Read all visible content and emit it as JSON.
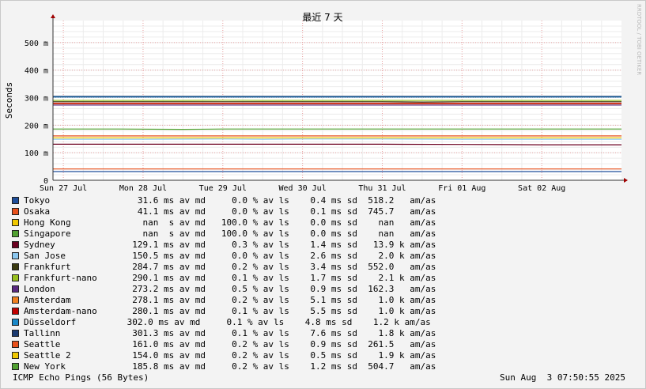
{
  "watermark": "RRDTOOL / TOBI OETIKER",
  "chart_data": {
    "type": "line",
    "title": "最近 7 天",
    "ylabel": "Seconds",
    "y_tick_labels": [
      "0",
      "100 m",
      "200 m",
      "300 m",
      "400 m",
      "500 m"
    ],
    "y_ticks": [
      0,
      0.1,
      0.2,
      0.3,
      0.4,
      0.5
    ],
    "ylim": [
      0,
      0.58
    ],
    "x_tick_labels": [
      "Sun 27 Jul",
      "Mon 28 Jul",
      "Tue 29 Jul",
      "Wed 30 Jul",
      "Thu 31 Jul",
      "Fri 01 Aug",
      "Sat 02 Aug"
    ],
    "x_ticks": [
      0,
      1,
      2,
      3,
      4,
      5,
      6
    ],
    "xlim": [
      -0.13,
      7.0
    ],
    "grid": true,
    "series": [
      {
        "name": "Tokyo",
        "color": "#1f4e9a",
        "x": [
          -0.13,
          0.8,
          1.7,
          2.0,
          2.5,
          3.0,
          3.5,
          4.0,
          4.5,
          5.0,
          5.5,
          6.0,
          7.0
        ],
        "values": [
          0.0316,
          0.0316,
          0.0316,
          0.0316,
          0.0316,
          0.0316,
          0.0316,
          0.0316,
          0.0316,
          0.0316,
          0.0316,
          0.0316,
          0.0316
        ]
      },
      {
        "name": "Osaka",
        "color": "#e8511c",
        "x": [
          -0.13,
          0.8,
          1.7,
          2.0,
          2.5,
          3.0,
          3.5,
          4.0,
          4.5,
          5.0,
          5.5,
          6.0,
          7.0
        ],
        "values": [
          0.0411,
          0.0411,
          0.0411,
          0.0411,
          0.0411,
          0.0411,
          0.0411,
          0.0411,
          0.0411,
          0.0411,
          0.0411,
          0.0411,
          0.0411
        ]
      },
      {
        "name": "Sydney",
        "color": "#6b0020",
        "x": [
          -0.13,
          0.8,
          1.7,
          2.0,
          2.1,
          2.5,
          3.0,
          4.0,
          5.0,
          6.0,
          7.0
        ],
        "values": [
          0.131,
          0.131,
          0.131,
          0.131,
          0.131,
          0.131,
          0.131,
          0.131,
          0.13,
          0.129,
          0.129
        ]
      },
      {
        "name": "San Jose",
        "color": "#8cc8f0",
        "x": [
          -0.13,
          1.0,
          2.0,
          2.5,
          3.0,
          4.0,
          5.0,
          6.0,
          7.0
        ],
        "values": [
          0.149,
          0.149,
          0.15,
          0.149,
          0.15,
          0.15,
          0.149,
          0.149,
          0.149
        ]
      },
      {
        "name": "Frankfurt",
        "color": "#3a3a10",
        "x": [
          -0.13,
          0.7,
          1.5,
          2.0,
          2.5,
          3.0,
          3.5,
          4.0,
          4.5,
          5.0,
          5.5,
          6.0,
          7.0
        ],
        "values": [
          0.285,
          0.285,
          0.285,
          0.285,
          0.285,
          0.285,
          0.285,
          0.285,
          0.284,
          0.285,
          0.285,
          0.285,
          0.285
        ]
      },
      {
        "name": "Frankfurt-nano",
        "color": "#98c020",
        "x": [
          -0.13,
          0.7,
          1.5,
          2.0,
          2.5,
          3.0,
          3.5,
          4.0,
          4.5,
          5.0,
          5.5,
          6.0,
          7.0
        ],
        "values": [
          0.29,
          0.29,
          0.29,
          0.291,
          0.29,
          0.29,
          0.29,
          0.29,
          0.29,
          0.29,
          0.29,
          0.29,
          0.29
        ]
      },
      {
        "name": "London",
        "color": "#5a2a80",
        "x": [
          -0.13,
          0.7,
          1.5,
          2.0,
          2.5,
          3.0,
          3.5,
          4.0,
          4.5,
          5.0,
          5.5,
          6.0,
          7.0
        ],
        "values": [
          0.273,
          0.273,
          0.273,
          0.273,
          0.273,
          0.273,
          0.273,
          0.273,
          0.273,
          0.273,
          0.273,
          0.273,
          0.273
        ]
      },
      {
        "name": "Amsterdam",
        "color": "#f08020",
        "x": [
          -0.13,
          0.7,
          1.5,
          2.0,
          2.5,
          3.0,
          3.5,
          4.0,
          4.5,
          5.0,
          5.5,
          6.0,
          7.0
        ],
        "values": [
          0.278,
          0.278,
          0.278,
          0.278,
          0.278,
          0.278,
          0.278,
          0.278,
          0.278,
          0.278,
          0.278,
          0.278,
          0.278
        ]
      },
      {
        "name": "Amsterdam-nano",
        "color": "#c00000",
        "x": [
          -0.13,
          0.7,
          1.5,
          2.0,
          2.5,
          3.0,
          3.5,
          4.0,
          4.5,
          5.0,
          5.5,
          6.0,
          7.0
        ],
        "values": [
          0.28,
          0.28,
          0.28,
          0.28,
          0.28,
          0.28,
          0.28,
          0.28,
          0.28,
          0.28,
          0.28,
          0.28,
          0.28
        ]
      },
      {
        "name": "Düsseldorf",
        "color": "#1a88c8",
        "x": [
          -0.13,
          0.7,
          1.5,
          2.0,
          2.5,
          3.0,
          3.5,
          4.0,
          4.5,
          5.0,
          5.5,
          6.0,
          7.0
        ],
        "values": [
          0.302,
          0.302,
          0.302,
          0.302,
          0.302,
          0.302,
          0.302,
          0.302,
          0.302,
          0.302,
          0.302,
          0.302,
          0.302
        ]
      },
      {
        "name": "Tallinn",
        "color": "#1a3a70",
        "x": [
          -0.13,
          0.7,
          1.5,
          2.0,
          2.5,
          3.0,
          3.5,
          4.0,
          4.5,
          5.0,
          5.5,
          6.0,
          7.0
        ],
        "values": [
          0.305,
          0.305,
          0.305,
          0.305,
          0.305,
          0.305,
          0.305,
          0.305,
          0.305,
          0.305,
          0.305,
          0.305,
          0.305
        ]
      },
      {
        "name": "Seattle",
        "color": "#e8511c",
        "x": [
          -0.13,
          0.6,
          1.0,
          1.8,
          2.5,
          2.8,
          3.5,
          4.0,
          4.4,
          4.5,
          5.0,
          5.5,
          6.0,
          7.0
        ],
        "values": [
          0.161,
          0.161,
          0.161,
          0.161,
          0.161,
          0.161,
          0.161,
          0.161,
          0.161,
          0.161,
          0.161,
          0.161,
          0.161,
          0.161
        ]
      },
      {
        "name": "Seattle 2",
        "color": "#f0c800",
        "x": [
          -0.13,
          1.0,
          1.8,
          2.0,
          2.5,
          3.0,
          4.0,
          5.0,
          6.0,
          7.0
        ],
        "values": [
          0.154,
          0.154,
          0.154,
          0.154,
          0.154,
          0.154,
          0.154,
          0.154,
          0.154,
          0.154
        ]
      },
      {
        "name": "New York",
        "color": "#50a030",
        "x": [
          -0.13,
          0.7,
          1.5,
          2.0,
          2.5,
          3.0,
          3.5,
          4.0,
          4.5,
          5.0,
          5.5,
          6.0,
          7.0
        ],
        "values": [
          0.186,
          0.186,
          0.185,
          0.186,
          0.186,
          0.186,
          0.186,
          0.186,
          0.186,
          0.186,
          0.186,
          0.186,
          0.186
        ]
      }
    ]
  },
  "legend": [
    {
      "name": "Tokyo",
      "color": "#1f4e9a",
      "stats": "   31.6 ms av md     0.0 % av ls    0.4 ms sd  518.2   am/as"
    },
    {
      "name": "Osaka",
      "color": "#e8511c",
      "stats": "   41.1 ms av md     0.0 % av ls    0.1 ms sd  745.7   am/as"
    },
    {
      "name": "Hong Kong",
      "color": "#f0c800",
      "stats": "    nan  s av md   100.0 % av ls    0.0 ms sd    nan   am/as"
    },
    {
      "name": "Singapore",
      "color": "#50a030",
      "stats": "    nan  s av md   100.0 % av ls    0.0 ms sd    nan   am/as"
    },
    {
      "name": "Sydney",
      "color": "#6b0020",
      "stats": "  129.1 ms av md     0.3 % av ls    1.4 ms sd   13.9 k am/as"
    },
    {
      "name": "San Jose",
      "color": "#8cc8f0",
      "stats": "  150.5 ms av md     0.0 % av ls    2.6 ms sd    2.0 k am/as"
    },
    {
      "name": "Frankfurt",
      "color": "#3a3a10",
      "stats": "  284.7 ms av md     0.2 % av ls    3.4 ms sd  552.0   am/as"
    },
    {
      "name": "Frankfurt-nano",
      "color": "#98c020",
      "stats": "  290.1 ms av md     0.1 % av ls    1.7 ms sd    2.1 k am/as"
    },
    {
      "name": "London",
      "color": "#5a2a80",
      "stats": "  273.2 ms av md     0.5 % av ls    0.9 ms sd  162.3   am/as"
    },
    {
      "name": "Amsterdam",
      "color": "#f08020",
      "stats": "  278.1 ms av md     0.2 % av ls    5.1 ms sd    1.0 k am/as"
    },
    {
      "name": "Amsterdam-nano",
      "color": "#c00000",
      "stats": "  280.1 ms av md     0.1 % av ls    5.5 ms sd    1.0 k am/as"
    },
    {
      "name": "Düsseldorf",
      "color": "#1a88c8",
      "stats": " 302.0 ms av md     0.1 % av ls    4.8 ms sd    1.2 k am/as"
    },
    {
      "name": "Tallinn",
      "color": "#1a3a70",
      "stats": "  301.3 ms av md     0.1 % av ls    7.6 ms sd    1.8 k am/as"
    },
    {
      "name": "Seattle",
      "color": "#e8511c",
      "stats": "  161.0 ms av md     0.2 % av ls    0.9 ms sd  261.5   am/as"
    },
    {
      "name": "Seattle 2",
      "color": "#f0c800",
      "stats": "  154.0 ms av md     0.2 % av ls    0.5 ms sd    1.9 k am/as"
    },
    {
      "name": "New York",
      "color": "#50a030",
      "stats": "  185.8 ms av md     0.2 % av ls    1.2 ms sd  504.7   am/as"
    }
  ],
  "footer": {
    "left": "ICMP Echo Pings (56 Bytes)",
    "right": "Sun Aug  3 07:50:55 2025"
  }
}
